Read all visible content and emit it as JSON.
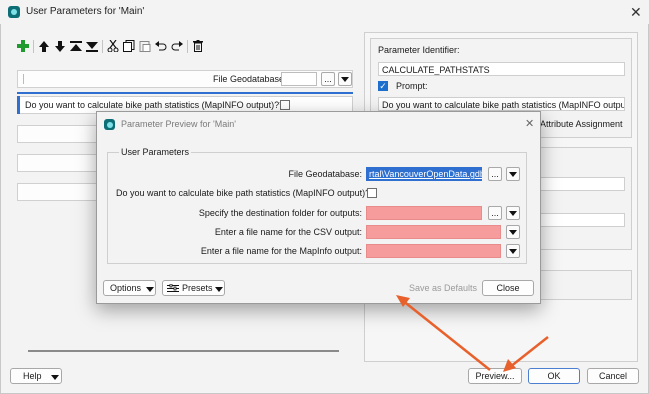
{
  "window": {
    "title": "User Parameters for 'Main'",
    "close_glyph": "✕"
  },
  "toolbar": {
    "items": [
      "add-icon",
      "move-up-icon",
      "move-down-icon",
      "move-top-icon",
      "move-bottom-icon",
      "cut-icon",
      "copy-icon",
      "paste-icon",
      "undo-icon",
      "redo-icon",
      "delete-icon"
    ]
  },
  "left_list": {
    "row1_label": "File Geodatabase:",
    "row1_required": "*",
    "row1_more": "...",
    "row2_label": "Do you want to calculate bike path statistics (MapINFO output)?",
    "row2_required": "*"
  },
  "right_panel": {
    "identifier_label": "Parameter Identifier:",
    "identifier_value": "CALCULATE_PATHSTATS",
    "prompt_checkbox_label": "Prompt:",
    "prompt_value": "Do you want to calculate bike path statistics (MapINFO output)?",
    "attribute_assignment_partial": "Attribute Assignment"
  },
  "bottom_bar": {
    "help_label": "Help",
    "preview_label": "Preview...",
    "ok_label": "OK",
    "cancel_label": "Cancel"
  },
  "preview_dialog": {
    "title": "Parameter Preview for 'Main'",
    "close_glyph": "✕",
    "group_title": "User Parameters",
    "gdb_label": "File Geodatabase:",
    "gdb_value": "rtal\\VancouverOpenData.gdb\"",
    "calc_label": "Do you want to calculate bike path statistics (MapINFO output)?",
    "dest_label": "Specify the destination folder for outputs:",
    "csv_label": "Enter a file name for the CSV output:",
    "mapinfo_label": "Enter a file name for the MapInfo output:",
    "more_label": "...",
    "options_label": "Options",
    "presets_label": "Presets",
    "save_defaults_label": "Save as Defaults",
    "close_label": "Close"
  },
  "colors": {
    "required_field": "#f79c9c",
    "selection_blue": "#2e6fd0",
    "annotation_arrow": "#e8612c"
  }
}
